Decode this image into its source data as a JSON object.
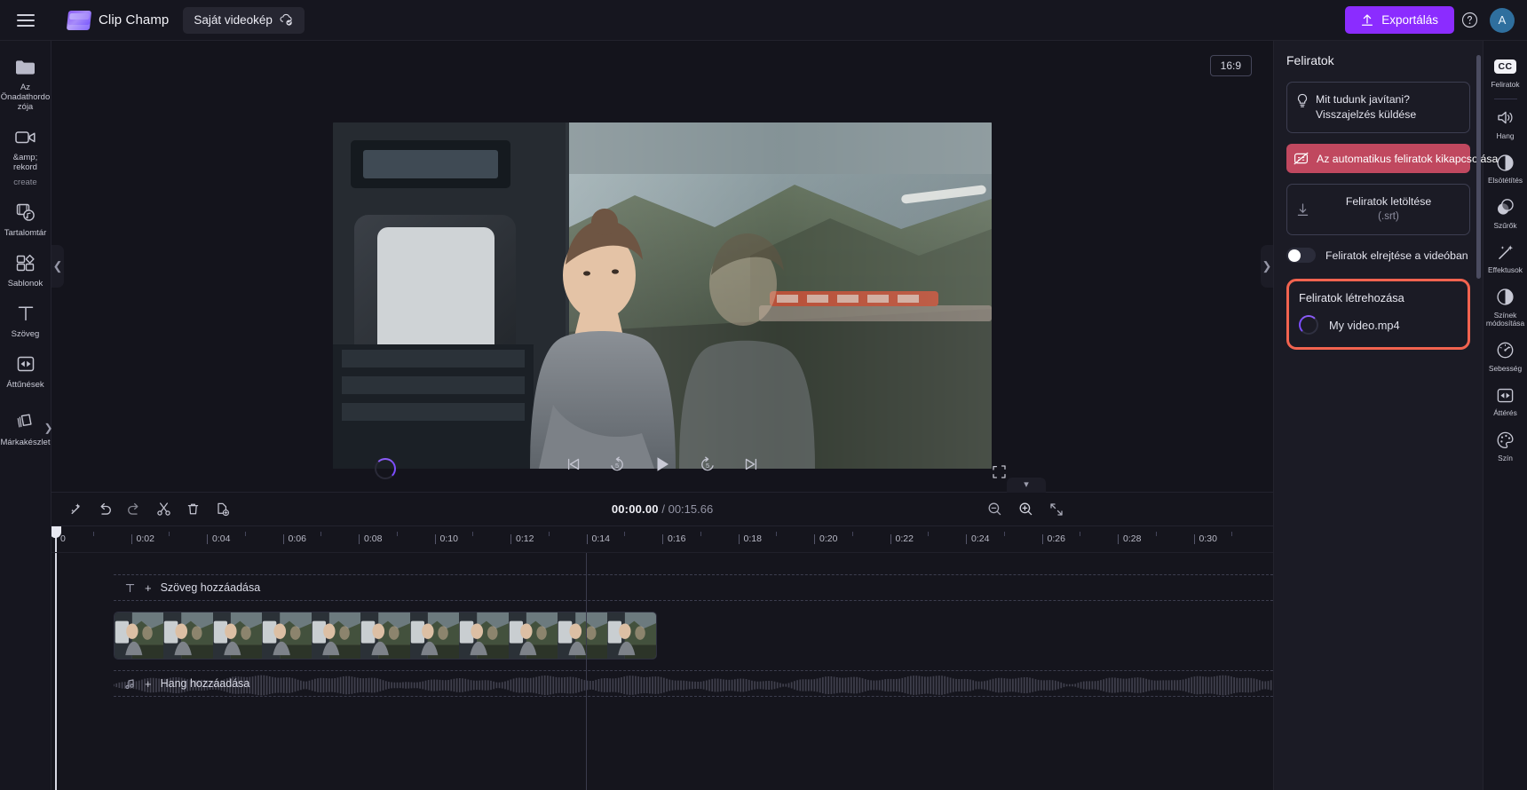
{
  "topbar": {
    "menu_icon": "hamburger-icon",
    "brand": "Clip Champ",
    "project_name": "Saját videokép",
    "project_status_icon": "cloud-synced-icon",
    "export_label": "Exportálás",
    "export_icon": "upload-icon",
    "export_color": "#8b2cff",
    "help_icon": "help-circle-icon",
    "avatar_initial": "A"
  },
  "left_rail": {
    "items": [
      {
        "label": "Az Önadathordozója",
        "icon": "folder-icon",
        "dim": false
      },
      {
        "label": "&amp; rekord",
        "label2": "create",
        "icon": "video-camera-icon",
        "dim": true
      },
      {
        "label": "Tartalomtár",
        "icon": "media-library-icon",
        "dim": false
      },
      {
        "label": "Sablonok",
        "icon": "templates-icon",
        "dim": false
      },
      {
        "label": "Szöveg",
        "icon": "text-t-icon",
        "dim": false
      },
      {
        "label": "Áttűnések",
        "icon": "transitions-icon",
        "dim": false
      },
      {
        "label": "Márkakészlet",
        "icon": "brand-kit-icon",
        "dim": false
      }
    ]
  },
  "stage": {
    "aspect_ratio": "16:9",
    "collapse_left_icon": "chevron-left-icon",
    "collapse_right_icon": "chevron-right-icon",
    "loading_icon": "loading-spinner",
    "fullscreen_icon": "fullscreen-icon",
    "transport": [
      {
        "name": "skip-to-start-button",
        "icon": "skip-start-icon"
      },
      {
        "name": "rewind-5s-button",
        "icon": "rewind-5-icon"
      },
      {
        "name": "play-button",
        "icon": "play-icon"
      },
      {
        "name": "forward-5s-button",
        "icon": "forward-5-icon"
      },
      {
        "name": "skip-to-end-button",
        "icon": "skip-end-icon"
      }
    ]
  },
  "timeline": {
    "tools": [
      {
        "name": "magic-wand-button",
        "icon": "magic-wand-icon"
      },
      {
        "name": "undo-button",
        "icon": "undo-icon"
      },
      {
        "name": "redo-button",
        "icon": "redo-icon"
      },
      {
        "name": "split-button",
        "icon": "scissors-icon"
      },
      {
        "name": "delete-button",
        "icon": "trash-icon"
      },
      {
        "name": "duplicate-button",
        "icon": "duplicate-icon"
      }
    ],
    "current_time": "00:00.00",
    "duration": "/ 00:15.66",
    "zoom_out_icon": "zoom-out-icon",
    "zoom_in_icon": "zoom-in-icon",
    "fit-icon": "fit-to-screen-icon",
    "collapse_icon": "chevron-down-icon",
    "ruler_ticks": [
      "0",
      "0:02",
      "0:04",
      "0:06",
      "0:08",
      "0:10",
      "0:12",
      "0:14",
      "0:16",
      "0:18",
      "0:20",
      "0:22",
      "0:24",
      "0:26",
      "0:28",
      "0:30"
    ],
    "tracks": {
      "text_row": "Szöveg hozzáadása",
      "text_row_icon": "text-t-icon",
      "audio_row": "Hang hozzáadása",
      "audio_row_icon": "music-note-icon",
      "clip_audio_icon": "speaker-icon"
    }
  },
  "right_panel": {
    "title": "Feliratok",
    "feedback": {
      "icon": "lightbulb-icon",
      "line1": "Mit tudunk javítani?",
      "line2": "Visszajelzés küldése"
    },
    "disable_button": {
      "icon": "captions-off-icon",
      "label": "Az automatikus feliratok kikapcsolása",
      "color": "#c0485f"
    },
    "download": {
      "icon": "download-icon",
      "label": "Feliratok letöltése",
      "sub": "(.srt)"
    },
    "hide_toggle": {
      "label": "Feliratok elrejtése a videóban",
      "state": "off"
    },
    "creating": {
      "title": "Feliratok létrehozása",
      "file": "My video.mp4",
      "spinner_icon": "loading-spinner",
      "highlight_color": "#f2634f"
    }
  },
  "right_rail": {
    "items": [
      {
        "label": "Feliratok",
        "icon": "cc-icon",
        "active": true
      },
      {
        "label": "Hang",
        "icon": "speaker-icon",
        "active": false
      },
      {
        "label": "Elsötétítés",
        "icon": "fade-icon",
        "active": false
      },
      {
        "label": "Szűrők",
        "icon": "filters-icon",
        "active": false
      },
      {
        "label": "Effektusok",
        "icon": "effects-wand-icon",
        "active": false
      },
      {
        "label": "Színek módosítása",
        "icon": "contrast-icon",
        "active": false
      },
      {
        "label": "Sebesség",
        "icon": "speedometer-icon",
        "active": false
      },
      {
        "label": "Áttérés",
        "icon": "transitions-icon",
        "active": false
      },
      {
        "label": "Szín",
        "icon": "palette-icon",
        "active": false
      }
    ]
  }
}
